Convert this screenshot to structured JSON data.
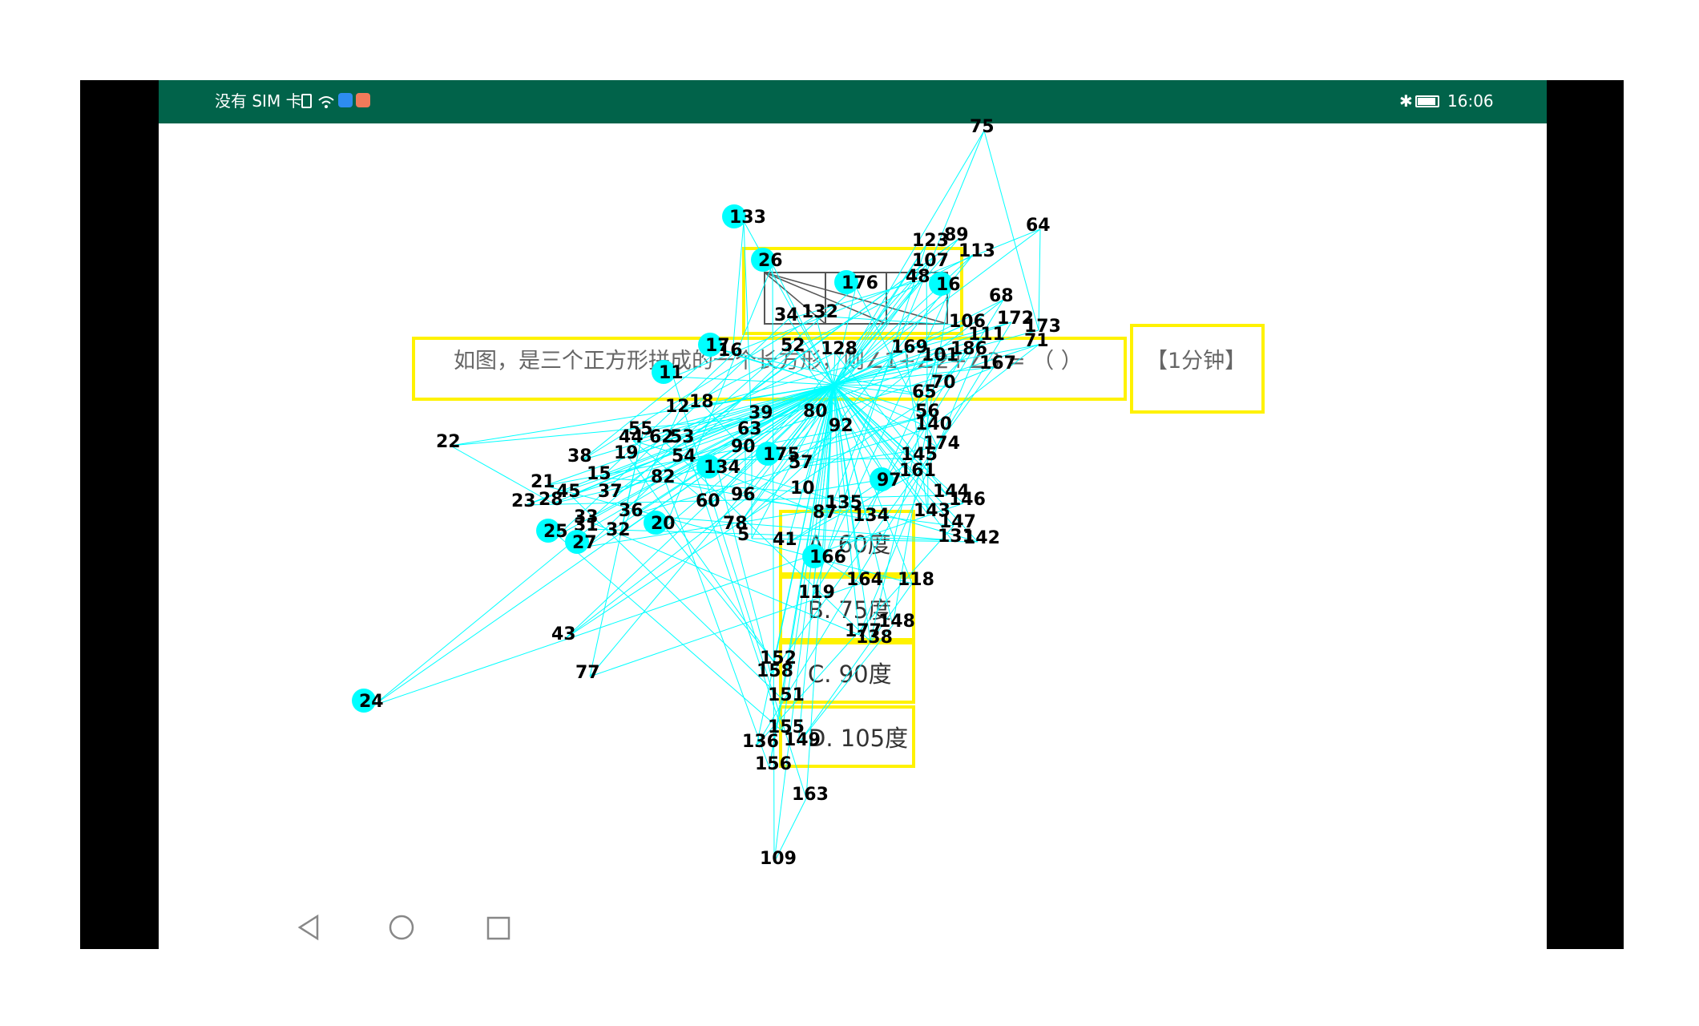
{
  "status_bar": {
    "left_text": "没有 SIM 卡",
    "time": "16:06",
    "bg_color": "#01634a"
  },
  "question": {
    "text": "如图，是三个正方形拼成的一个长方形，则∠1+∠2+∠3 = （ ）",
    "tag": "【1分钟】"
  },
  "options": [
    {
      "label": "A. 60度"
    },
    {
      "label": "B. 75度"
    },
    {
      "label": "C. 90度"
    },
    {
      "label": "D. 105度"
    }
  ],
  "overlay": {
    "node_color": "#00ffff",
    "box_color": "#fff200",
    "nodes": [
      {
        "id": "75"
      },
      {
        "id": "133"
      },
      {
        "id": "64"
      },
      {
        "id": "123"
      },
      {
        "id": "89"
      },
      {
        "id": "113"
      },
      {
        "id": "26"
      },
      {
        "id": "107"
      },
      {
        "id": "176"
      },
      {
        "id": "48"
      },
      {
        "id": "16"
      },
      {
        "id": "68"
      },
      {
        "id": "172"
      },
      {
        "id": "173"
      },
      {
        "id": "34"
      },
      {
        "id": "132"
      },
      {
        "id": "106"
      },
      {
        "id": "111"
      },
      {
        "id": "71"
      },
      {
        "id": "17"
      },
      {
        "id": "16"
      },
      {
        "id": "52"
      },
      {
        "id": "128"
      },
      {
        "id": "169"
      },
      {
        "id": "101"
      },
      {
        "id": "186"
      },
      {
        "id": "167"
      },
      {
        "id": "11"
      },
      {
        "id": "12"
      },
      {
        "id": "18"
      },
      {
        "id": "65"
      },
      {
        "id": "70"
      },
      {
        "id": "22"
      },
      {
        "id": "39"
      },
      {
        "id": "80"
      },
      {
        "id": "92"
      },
      {
        "id": "56"
      },
      {
        "id": "140"
      },
      {
        "id": "55"
      },
      {
        "id": "44"
      },
      {
        "id": "62"
      },
      {
        "id": "53"
      },
      {
        "id": "63"
      },
      {
        "id": "174"
      },
      {
        "id": "38"
      },
      {
        "id": "19"
      },
      {
        "id": "90"
      },
      {
        "id": "175"
      },
      {
        "id": "57"
      },
      {
        "id": "145"
      },
      {
        "id": "54"
      },
      {
        "id": "15"
      },
      {
        "id": "134"
      },
      {
        "id": "161"
      },
      {
        "id": "21"
      },
      {
        "id": "20"
      },
      {
        "id": "82"
      },
      {
        "id": "37"
      },
      {
        "id": "97"
      },
      {
        "id": "45"
      },
      {
        "id": "23"
      },
      {
        "id": "28"
      },
      {
        "id": "60"
      },
      {
        "id": "96"
      },
      {
        "id": "10"
      },
      {
        "id": "144"
      },
      {
        "id": "146"
      },
      {
        "id": "135"
      },
      {
        "id": "36"
      },
      {
        "id": "33"
      },
      {
        "id": "31"
      },
      {
        "id": "87"
      },
      {
        "id": "143"
      },
      {
        "id": "25"
      },
      {
        "id": "27"
      },
      {
        "id": "32"
      },
      {
        "id": "78"
      },
      {
        "id": "5"
      },
      {
        "id": "41"
      },
      {
        "id": "134"
      },
      {
        "id": "147"
      },
      {
        "id": "131"
      },
      {
        "id": "142"
      },
      {
        "id": "166"
      },
      {
        "id": "164"
      },
      {
        "id": "118"
      },
      {
        "id": "119"
      },
      {
        "id": "148"
      },
      {
        "id": "177"
      },
      {
        "id": "138"
      },
      {
        "id": "43"
      },
      {
        "id": "77"
      },
      {
        "id": "152"
      },
      {
        "id": "158"
      },
      {
        "id": "151"
      },
      {
        "id": "24"
      },
      {
        "id": "155"
      },
      {
        "id": "136"
      },
      {
        "id": "149"
      },
      {
        "id": "156"
      },
      {
        "id": "163"
      },
      {
        "id": "109"
      }
    ]
  }
}
